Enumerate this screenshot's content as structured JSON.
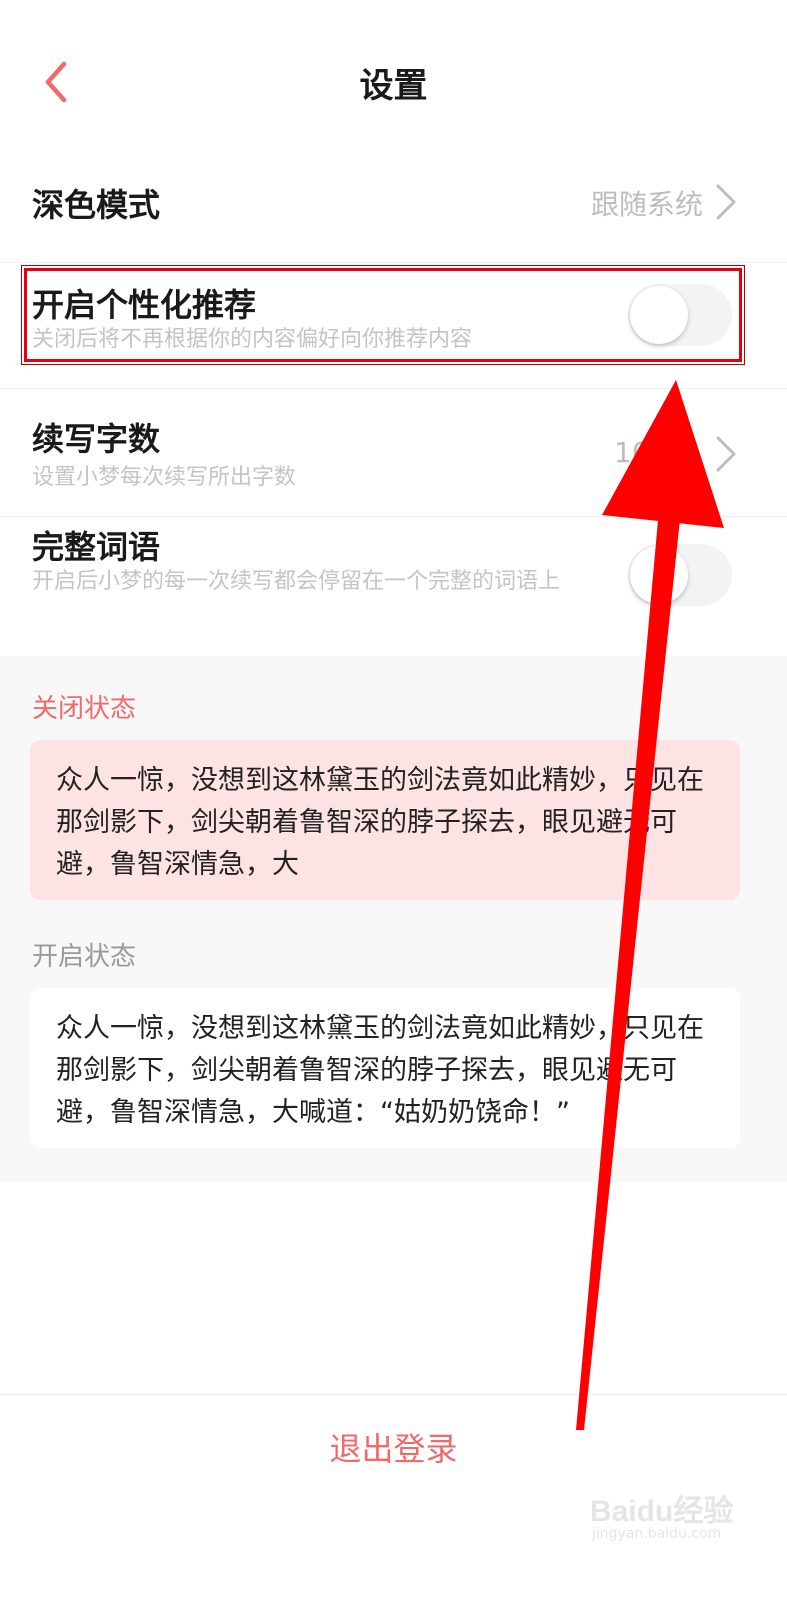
{
  "header": {
    "title": "设置"
  },
  "settings": {
    "dark_mode": {
      "label": "深色模式",
      "value": "跟随系统"
    },
    "personalized": {
      "label": "开启个性化推荐",
      "description": "关闭后将不再根据你的内容偏好向你推荐内容",
      "enabled": false
    },
    "continue_words": {
      "label": "续写字数",
      "description": "设置小梦每次续写所出字数",
      "value": "10"
    },
    "complete_words": {
      "label": "完整词语",
      "description": "开启后小梦的每一次续写都会停留在一个完整的词语上",
      "enabled": false
    }
  },
  "examples": {
    "off": {
      "label": "关闭状态",
      "text": "众人一惊，没想到这林黛玉的剑法竟如此精妙，只见在那剑影下，剑尖朝着鲁智深的脖子探去，眼见避无可避，鲁智深情急，大"
    },
    "on": {
      "label": "开启状态",
      "text": "众人一惊，没想到这林黛玉的剑法竟如此精妙，只见在那剑影下，剑尖朝着鲁智深的脖子探去，眼见避无可避，鲁智深情急，大喊道：“姑奶奶饶命！”"
    }
  },
  "logout": {
    "label": "退出登录"
  },
  "watermark": {
    "brand": "Baidu经验",
    "site": "jingyan.baidu.com"
  },
  "colors": {
    "accent": "#f06a6a",
    "annotation_red": "#e60012",
    "pink_bg": "#fde3e4"
  }
}
